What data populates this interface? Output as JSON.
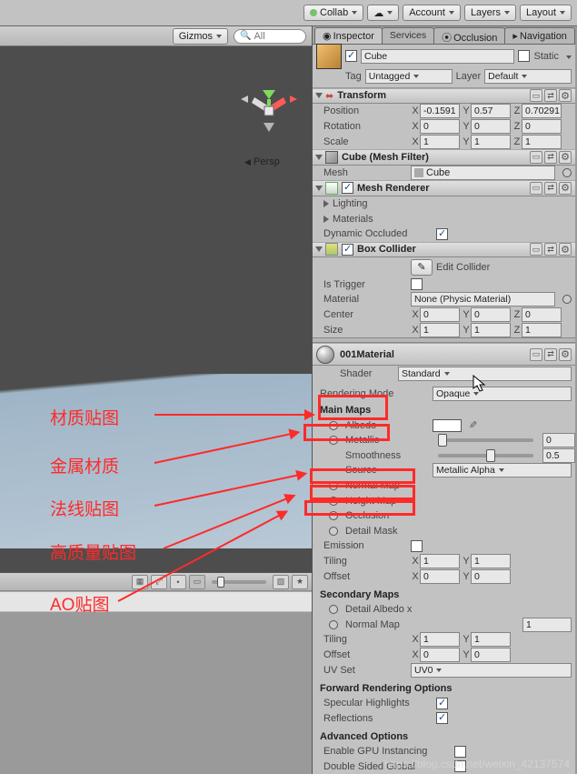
{
  "topbar": {
    "collab": "Collab",
    "account": "Account",
    "layers": "Layers",
    "layout": "Layout"
  },
  "sceneToolbar": {
    "gizmos": "Gizmos",
    "search_placeholder": "All"
  },
  "persp": "Persp",
  "tabs": {
    "inspector": "Inspector",
    "services": "Services",
    "occlusion": "Occlusion",
    "navigation": "Navigation"
  },
  "obj": {
    "name": "Cube",
    "static": "Static",
    "tagLabel": "Tag",
    "tagValue": "Untagged",
    "layerLabel": "Layer",
    "layerValue": "Default"
  },
  "transform": {
    "title": "Transform",
    "position": "Position",
    "px": "-0.1591",
    "py": "0.57",
    "pz": "0.70291",
    "rotation": "Rotation",
    "rx": "0",
    "ry": "0",
    "rz": "0",
    "scale": "Scale",
    "sx": "1",
    "sy": "1",
    "sz": "1"
  },
  "meshfilter": {
    "title": "Cube (Mesh Filter)",
    "mesh": "Mesh",
    "value": "Cube"
  },
  "renderer": {
    "title": "Mesh Renderer",
    "lighting": "Lighting",
    "materials": "Materials",
    "dyn": "Dynamic Occluded"
  },
  "collider": {
    "title": "Box Collider",
    "edit": "Edit Collider",
    "isTrigger": "Is Trigger",
    "material": "Material",
    "matValue": "None (Physic Material)",
    "center": "Center",
    "cx": "0",
    "cy": "0",
    "cz": "0",
    "size": "Size",
    "sx": "1",
    "sy": "1",
    "sz": "1"
  },
  "mat": {
    "name": "001Material",
    "shaderLabel": "Shader",
    "shader": "Standard",
    "renderMode": "Rendering Mode",
    "renderValue": "Opaque",
    "mainMaps": "Main Maps",
    "albedo": "Albedo",
    "metallic": "Metallic",
    "metallicVal": "0",
    "smoothness": "Smoothness",
    "smoothVal": "0.5",
    "source": "Source",
    "sourceVal": "Metallic Alpha",
    "normal": "Normal Map",
    "height": "Height Map",
    "occl": "Occlusion",
    "detailMask": "Detail Mask",
    "emission": "Emission",
    "tiling": "Tiling",
    "tx1": "1",
    "ty1": "1",
    "offset": "Offset",
    "ox1": "0",
    "oy1": "0",
    "secMaps": "Secondary Maps",
    "detailAlbedo": "Detail Albedo x",
    "normal2": "Normal Map",
    "nm2val": "1",
    "tiling2": "Tiling",
    "tx2": "1",
    "ty2": "1",
    "offset2": "Offset",
    "ox2": "0",
    "oy2": "0",
    "uvset": "UV Set",
    "uvVal": "UV0",
    "fwd": "Forward Rendering Options",
    "spec": "Specular Highlights",
    "refl": "Reflections",
    "adv": "Advanced Options",
    "gpu": "Enable GPU Instancing",
    "dsg": "Double Sided Global"
  },
  "anno": {
    "a1": "材质贴图",
    "a2": "金属材质",
    "a3": "法线贴图",
    "a4": "高质量贴图",
    "a5": "AO贴图"
  },
  "watermark": "https://blog.csdn.net/weixin_42137574"
}
